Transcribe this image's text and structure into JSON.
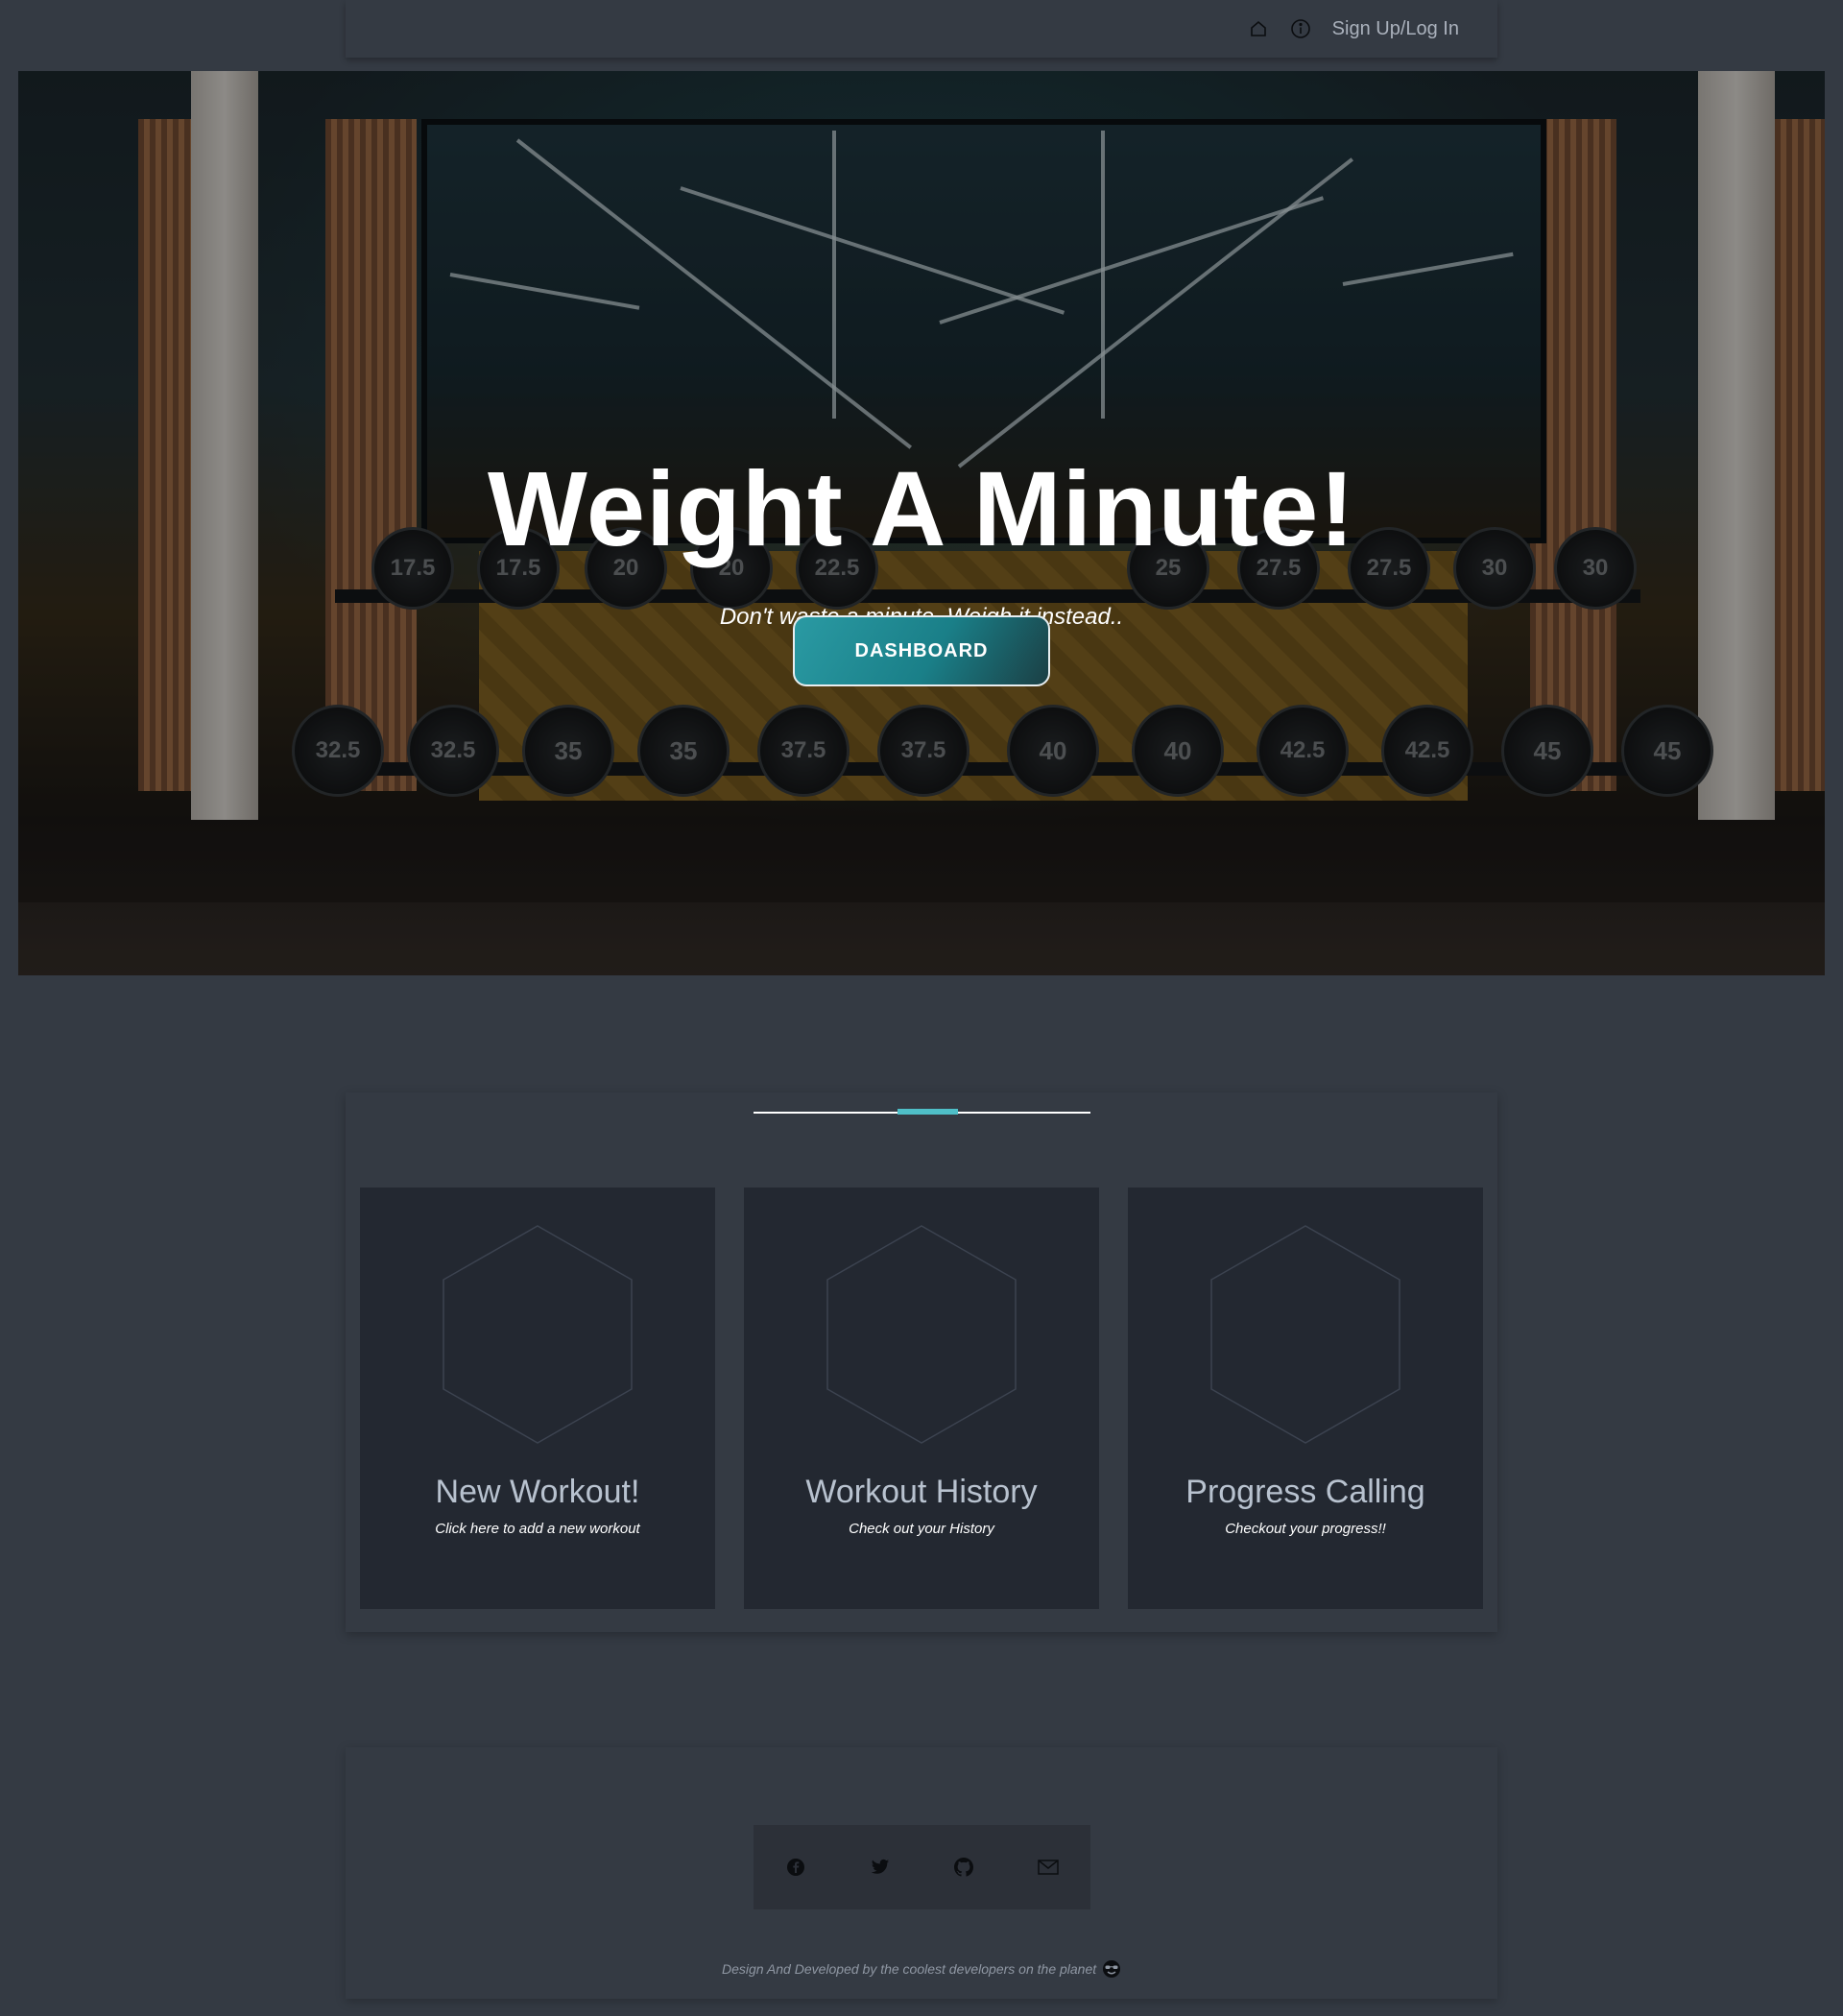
{
  "nav": {
    "home_icon": "home-icon",
    "info_icon": "info-icon",
    "auth_link": "Sign Up/Log In"
  },
  "hero": {
    "title": "Weight A Minute!",
    "subtitle": "Don't waste a minute, Weigh it instead..",
    "cta": "DASHBOARD",
    "accent_color": "#1a7f88"
  },
  "features": {
    "divider_accent_color": "#4fbfc8",
    "cards": [
      {
        "title": "New Workout!",
        "subtitle": "Click here to add a new workout"
      },
      {
        "title": "Workout History",
        "subtitle": "Check out your History"
      },
      {
        "title": "Progress Calling",
        "subtitle": "Checkout your progress!!"
      }
    ]
  },
  "footer": {
    "social_icons": [
      "facebook-icon",
      "twitter-icon",
      "github-icon",
      "email-icon"
    ],
    "credit": "Design And Developed by the coolest developers on the planet",
    "credit_emoji": "sunglasses-emoji"
  }
}
